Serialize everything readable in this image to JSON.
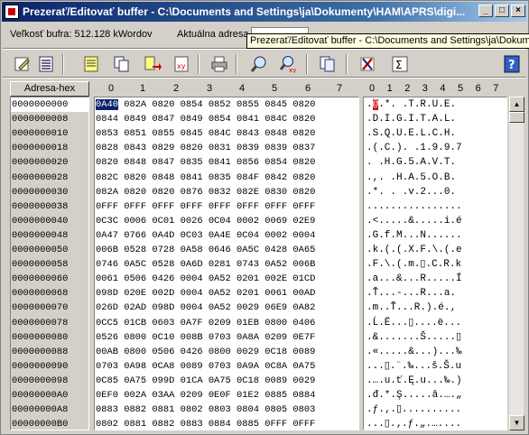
{
  "window": {
    "title": "Prezerať/Editovať buffer - C:\\Documents and Settings\\ja\\Dokumenty\\HAM\\APRS\\digi...",
    "buttons": {
      "minimize": "_",
      "maximize": "□",
      "close": "×"
    }
  },
  "info": {
    "buffer_size": "Veľkosť bufra: 512.128 kWordov",
    "current_address_label": "Aktuálna adresa"
  },
  "tooltip": "Prezerať/Editovať buffer - C:\\Documents and Settings\\ja\\Dokum",
  "toolbar": {
    "icons": [
      "edit-icon",
      "list-icon",
      "fill-icon",
      "copy-icon",
      "move-icon",
      "exchange-icon",
      "print-icon",
      "search-icon",
      "search-replace-icon",
      "pages-icon",
      "tools-icon",
      "checksum-icon",
      "help-icon"
    ],
    "help_label": "?",
    "checksum_label": "Σ"
  },
  "grid": {
    "address_header": "Adresa-hex",
    "hex_columns": [
      "0",
      "1",
      "2",
      "3",
      "4",
      "5",
      "6",
      "7"
    ],
    "ascii_columns": [
      "0",
      "1",
      "2",
      "3",
      "4",
      "5",
      "6",
      "7"
    ],
    "rows": [
      {
        "addr": "0000000000",
        "hex": [
          "0A40",
          "082A",
          "0820",
          "0854",
          "0852",
          "0855",
          "0845",
          "0820"
        ],
        "ascii": ".@.*. .T.R.U.E. "
      },
      {
        "addr": "0000000008",
        "hex": [
          "0844",
          "0849",
          "0847",
          "0849",
          "0854",
          "0841",
          "084C",
          "0820"
        ],
        "ascii": ".D.I.G.I.T.A.L. "
      },
      {
        "addr": "0000000010",
        "hex": [
          "0853",
          "0851",
          "0855",
          "0845",
          "084C",
          "0843",
          "0848",
          "0820"
        ],
        "ascii": ".S.Q.U.E.L.C.H. "
      },
      {
        "addr": "0000000018",
        "hex": [
          "0828",
          "0843",
          "0829",
          "0820",
          "0831",
          "0839",
          "0839",
          "0837"
        ],
        "ascii": ".(.C.). .1.9.9.7"
      },
      {
        "addr": "0000000020",
        "hex": [
          "0820",
          "0848",
          "0847",
          "0835",
          "0841",
          "0856",
          "0854",
          "0820"
        ],
        "ascii": ". .H.G.5.A.V.T. "
      },
      {
        "addr": "0000000028",
        "hex": [
          "082C",
          "0820",
          "0848",
          "0841",
          "0835",
          "084F",
          "0842",
          "0820"
        ],
        "ascii": ".,. .H.A.5.O.B. "
      },
      {
        "addr": "0000000030",
        "hex": [
          "082A",
          "0820",
          "0820",
          "0876",
          "0832",
          "082E",
          "0830",
          "0820"
        ],
        "ascii": ".*. . .v.2...0. "
      },
      {
        "addr": "0000000038",
        "hex": [
          "0FFF",
          "0FFF",
          "0FFF",
          "0FFF",
          "0FFF",
          "0FFF",
          "0FFF",
          "0FFF"
        ],
        "ascii": "................"
      },
      {
        "addr": "0000000040",
        "hex": [
          "0C3C",
          "0006",
          "0C01",
          "0026",
          "0C04",
          "0002",
          "0069",
          "02E9"
        ],
        "ascii": ".<.....&.....i.é"
      },
      {
        "addr": "0000000048",
        "hex": [
          "0A47",
          "0766",
          "0A4D",
          "0C03",
          "0A4E",
          "0C04",
          "0002",
          "0004"
        ],
        "ascii": ".G.f.M...N......"
      },
      {
        "addr": "0000000050",
        "hex": [
          "006B",
          "0528",
          "0728",
          "0A58",
          "0646",
          "0A5C",
          "0428",
          "0A65"
        ],
        "ascii": ".k.(.(.X.F.\\.(.e"
      },
      {
        "addr": "0000000058",
        "hex": [
          "0746",
          "0A5C",
          "0528",
          "0A6D",
          "0281",
          "0743",
          "0A52",
          "006B"
        ],
        "ascii": ".F.\\.(.m.▯.C.R.k"
      },
      {
        "addr": "0000000060",
        "hex": [
          "0061",
          "0506",
          "0426",
          "0004",
          "0A52",
          "0201",
          "002E",
          "01CD"
        ],
        "ascii": ".a...&...R.....Í"
      },
      {
        "addr": "0000000068",
        "hex": [
          "098D",
          "020E",
          "002D",
          "0004",
          "0A52",
          "0201",
          "0061",
          "00AD"
        ],
        "ascii": ".Ť...-...R...a.­"
      },
      {
        "addr": "0000000070",
        "hex": [
          "026D",
          "02AD",
          "098D",
          "0004",
          "0A52",
          "0029",
          "06E9",
          "0A82"
        ],
        "ascii": ".m.­.Ť...R.).é.‚"
      },
      {
        "addr": "0000000078",
        "hex": [
          "0CC5",
          "01CB",
          "0603",
          "0A7F",
          "0209",
          "01EB",
          "0800",
          "0406"
        ],
        "ascii": ".Ĺ.Ë...▯....ë..."
      },
      {
        "addr": "0000000080",
        "hex": [
          "0526",
          "0800",
          "0C10",
          "008B",
          "0703",
          "0A8A",
          "0209",
          "0E7F"
        ],
        "ascii": ".&.......Š.....▯"
      },
      {
        "addr": "0000000088",
        "hex": [
          "00AB",
          "0800",
          "0506",
          "0426",
          "0800",
          "0029",
          "0C18",
          "0089"
        ],
        "ascii": ".«.....&...)...‰"
      },
      {
        "addr": "0000000090",
        "hex": [
          "0703",
          "0A98",
          "0CA8",
          "0089",
          "0703",
          "0A9A",
          "0C8A",
          "0A75"
        ],
        "ascii": "...▯.¨.‰...š.Š.u"
      },
      {
        "addr": "0000000098",
        "hex": [
          "0C85",
          "0A75",
          "099D",
          "01CA",
          "0A75",
          "0C18",
          "0089",
          "0029"
        ],
        "ascii": ".….u.ť.Ę.u...‰.)"
      },
      {
        "addr": "00000000A0",
        "hex": [
          "0EF0",
          "002A",
          "03AA",
          "0209",
          "0E0F",
          "01E2",
          "0885",
          "0884"
        ],
        "ascii": ".đ.*.Ş.....â.….„"
      },
      {
        "addr": "00000000A8",
        "hex": [
          "0883",
          "0882",
          "0881",
          "0802",
          "0803",
          "0804",
          "0805",
          "0803"
        ],
        "ascii": ".ƒ.‚.▯.........."
      },
      {
        "addr": "00000000B0",
        "hex": [
          "0802",
          "0881",
          "0882",
          "0883",
          "0884",
          "0885",
          "0FFF",
          "0FFF"
        ],
        "ascii": "...▯.‚.ƒ.„.…...."
      }
    ]
  },
  "colors": {
    "title_start": "#0a246a",
    "title_end": "#a6caf0",
    "selection": "#0a246a",
    "cursor_char": "#cc0000"
  }
}
